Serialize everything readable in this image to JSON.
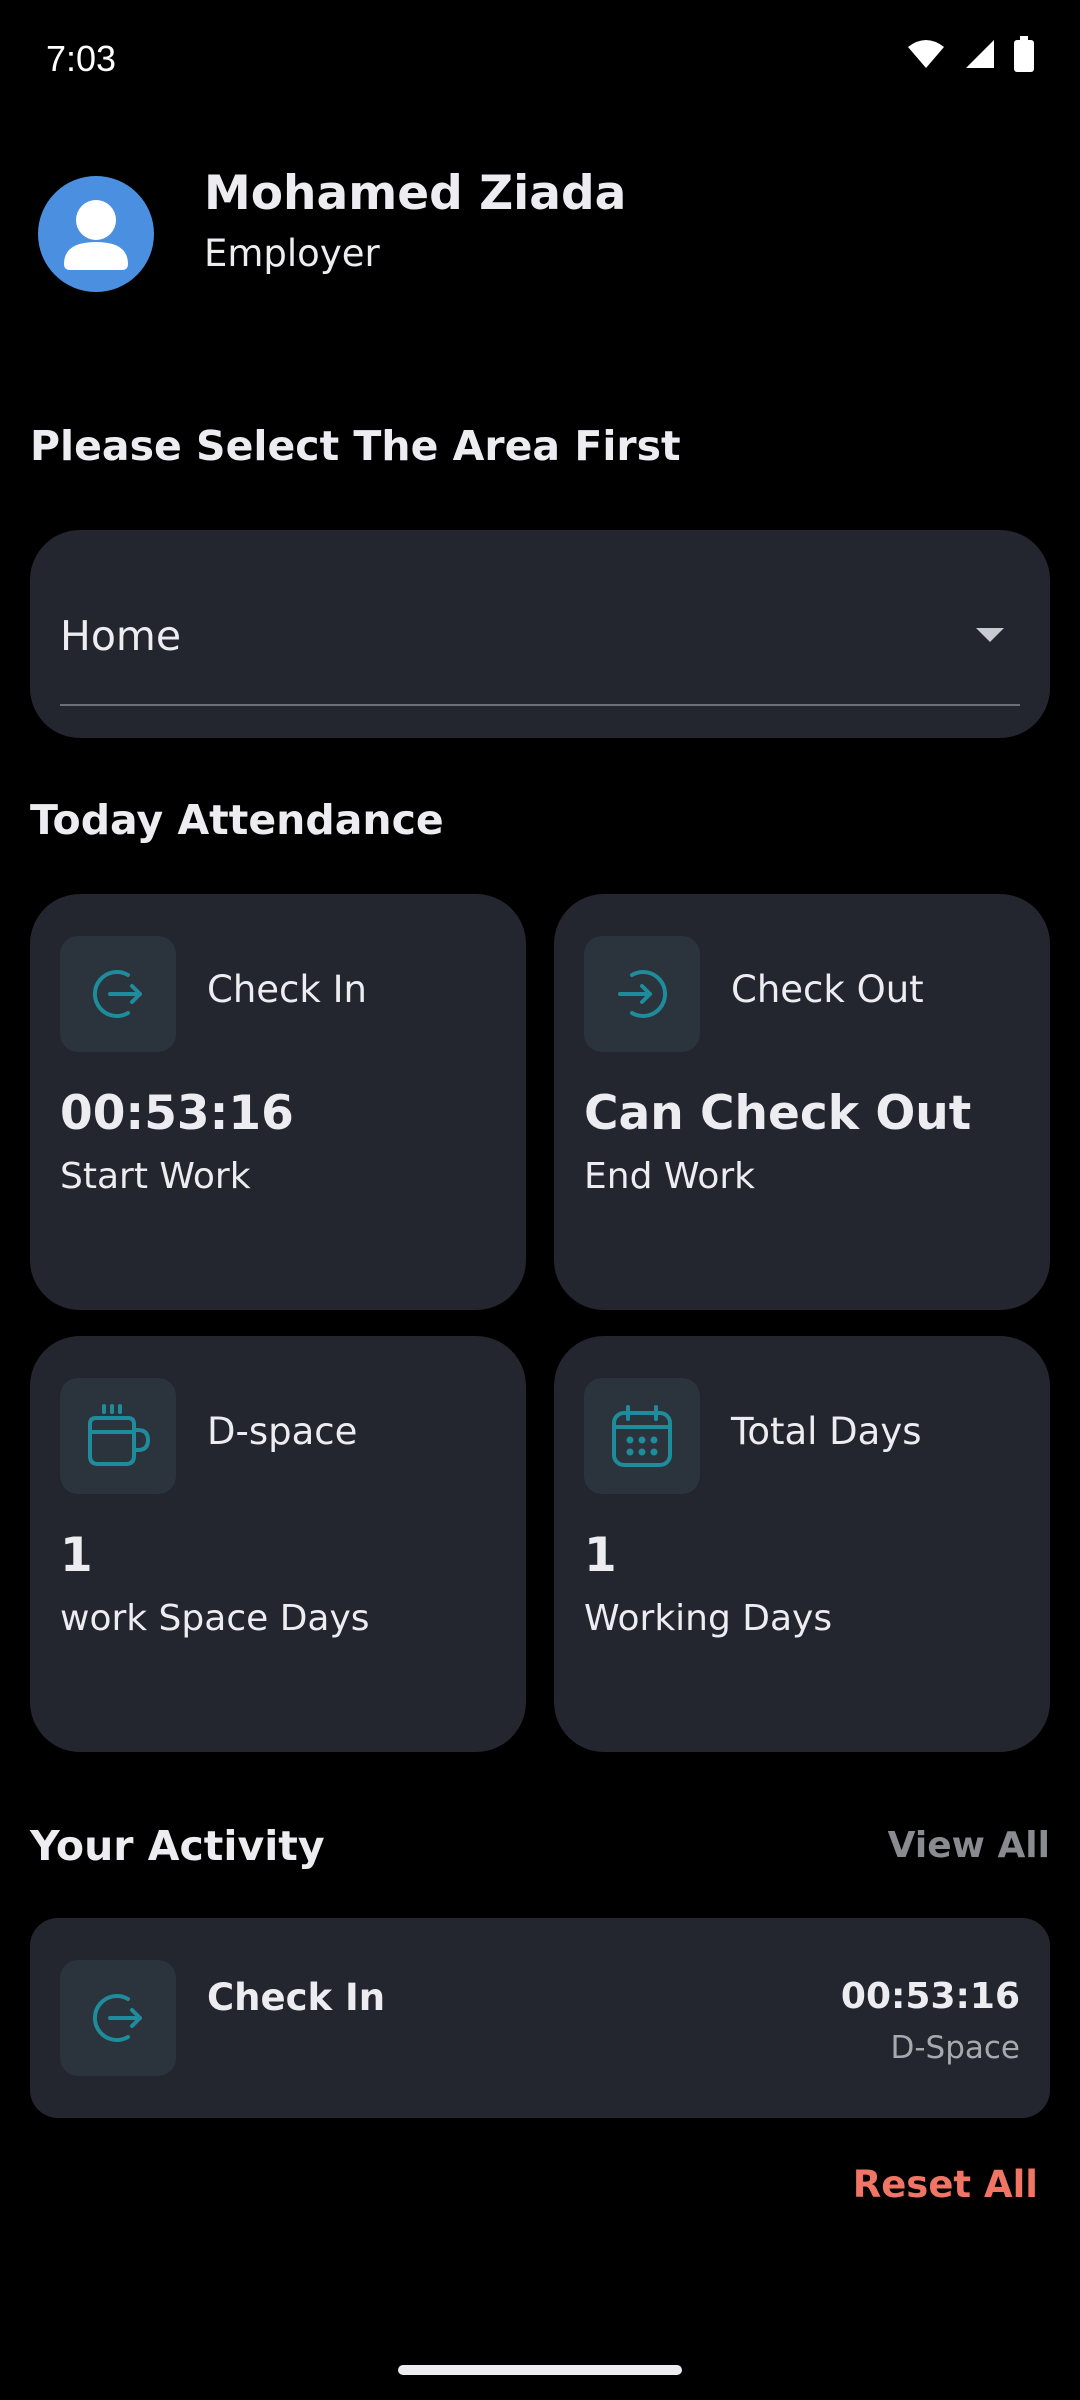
{
  "status_bar": {
    "time": "7:03"
  },
  "profile": {
    "name": "Mohamed Ziada",
    "role": "Employer"
  },
  "area": {
    "title": "Please Select The Area First",
    "selected": "Home"
  },
  "attendance": {
    "title": "Today Attendance",
    "cards": [
      {
        "label": "Check In",
        "value": "00:53:16",
        "sub": "Start Work",
        "icon": "login-icon"
      },
      {
        "label": "Check Out",
        "value": "Can Check Out",
        "sub": "End Work",
        "icon": "logout-icon"
      },
      {
        "label": "D-space",
        "value": "1",
        "sub": "work Space Days",
        "icon": "coffee-cup-icon"
      },
      {
        "label": "Total Days",
        "value": "1",
        "sub": "Working Days",
        "icon": "calendar-icon"
      }
    ]
  },
  "activity": {
    "title": "Your Activity",
    "view_all": "View All",
    "items": [
      {
        "title": "Check In",
        "time": "00:53:16",
        "place": "D-Space",
        "icon": "login-icon"
      }
    ]
  },
  "reset_all": "Reset All",
  "colors": {
    "accent": "#1E8C9A",
    "card": "#23262F",
    "reset": "#F07565",
    "avatar": "#4A8FE0"
  }
}
